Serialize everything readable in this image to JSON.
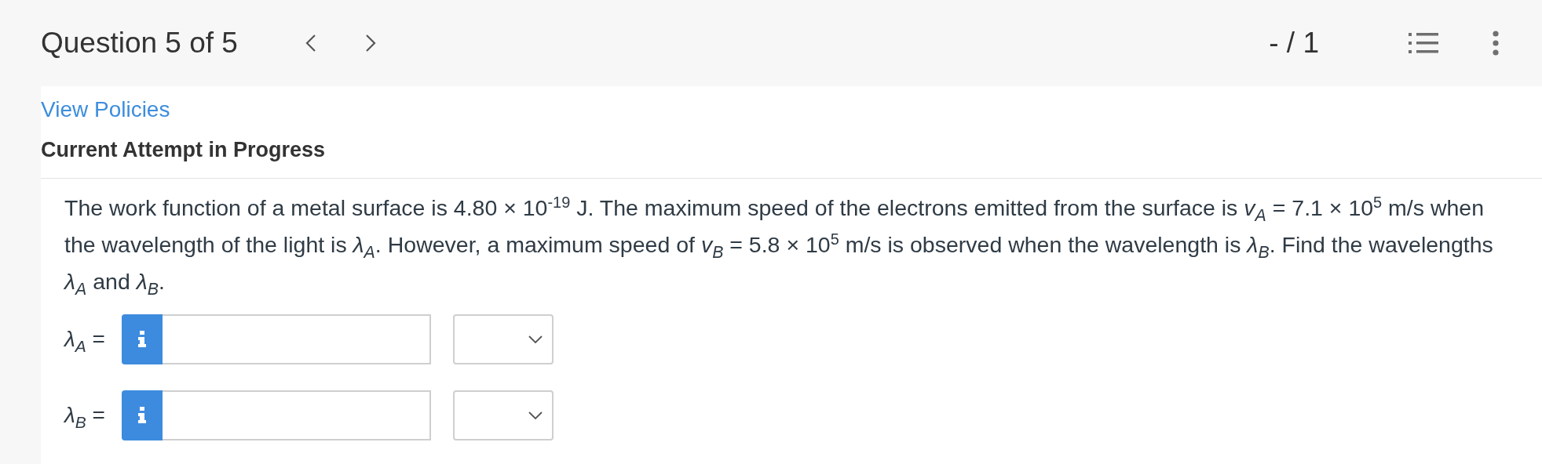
{
  "header": {
    "title": "Question 5 of 5",
    "score": "- / 1"
  },
  "policies_link": "View Policies",
  "attempt_heading": "Current Attempt in Progress",
  "question": "The work function of a metal surface is 4.80 × 10$^{-19}$ J. The maximum speed of the electrons emitted from the surface is *v*$_{A}$ = 7.1 × 10$^{5}$ m/s when the wavelength of the light is *λ*$_{A}$. However, a maximum speed of *v*$_{B}$ = 5.8 × 10$^{5}$ m/s is observed when the wavelength is *λ*$_{B}$. Find the wavelengths *λ*$_{A}$ and *λ*$_{B}$.",
  "answers": [
    {
      "label": "*λ*$_{A}$ ="
    },
    {
      "label": "*λ*$_{B}$ ="
    }
  ]
}
